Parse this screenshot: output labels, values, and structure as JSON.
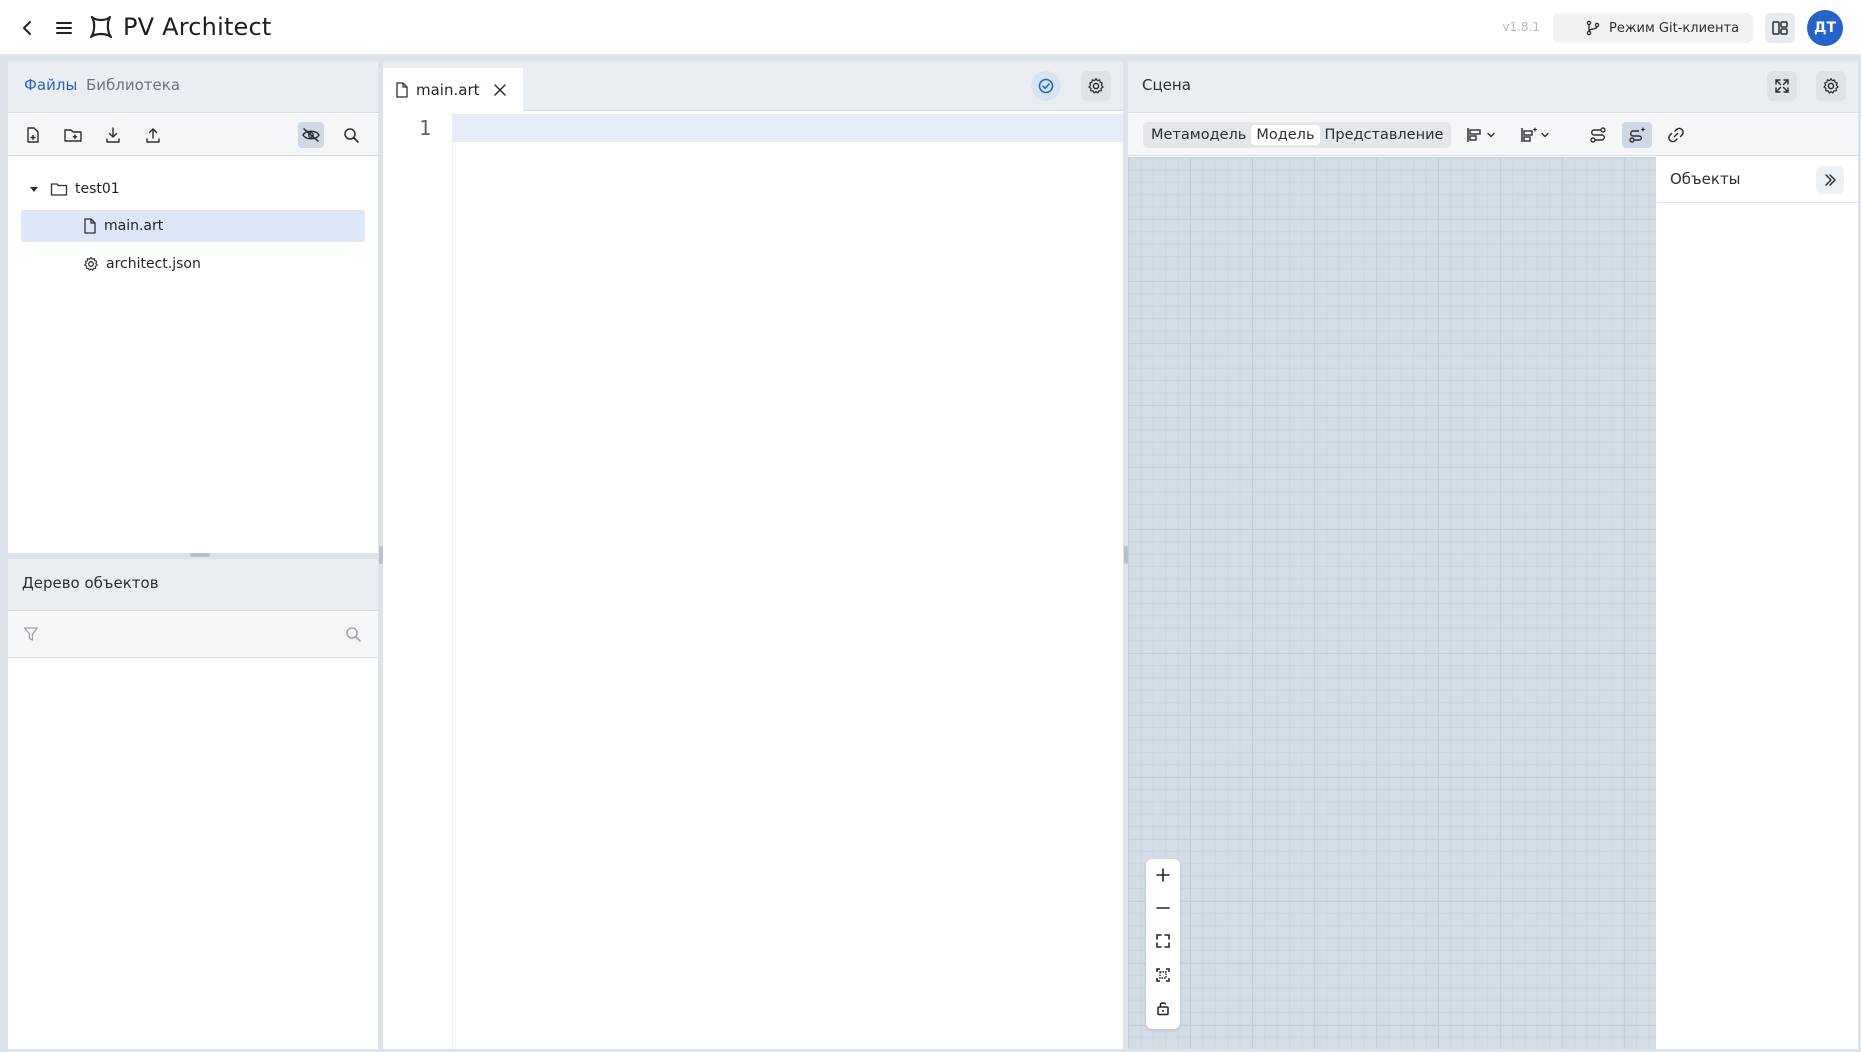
{
  "app": {
    "title": "PV Architect",
    "version": "v1.8.1",
    "git_mode_label": "Режим Git-клиента",
    "user_initials": "ДТ"
  },
  "colors": {
    "accent": "#2563c9",
    "canvas": "#d3dde6",
    "selection": "#dde7f7"
  },
  "files_panel": {
    "tabs": [
      {
        "label": "Файлы",
        "active": true
      },
      {
        "label": "Библиотека",
        "active": false
      }
    ],
    "toolbar": [
      "new-file-icon",
      "new-folder-icon",
      "download-icon",
      "upload-icon",
      "eye-off-icon",
      "search-icon"
    ],
    "tree": [
      {
        "label": "test01",
        "type": "folder",
        "expanded": true
      },
      {
        "label": "main.art",
        "type": "file",
        "selected": true
      },
      {
        "label": "architect.json",
        "type": "settings-file"
      }
    ]
  },
  "object_tree": {
    "title": "Дерево объектов"
  },
  "editor": {
    "tab_label": "main.art",
    "line_numbers": [
      "1"
    ]
  },
  "scene": {
    "title": "Сцена",
    "modes": [
      {
        "label": "Метамодель",
        "active": false
      },
      {
        "label": "Модель",
        "active": true
      },
      {
        "label": "Представление",
        "active": false
      }
    ],
    "objects_title": "Объекты"
  }
}
